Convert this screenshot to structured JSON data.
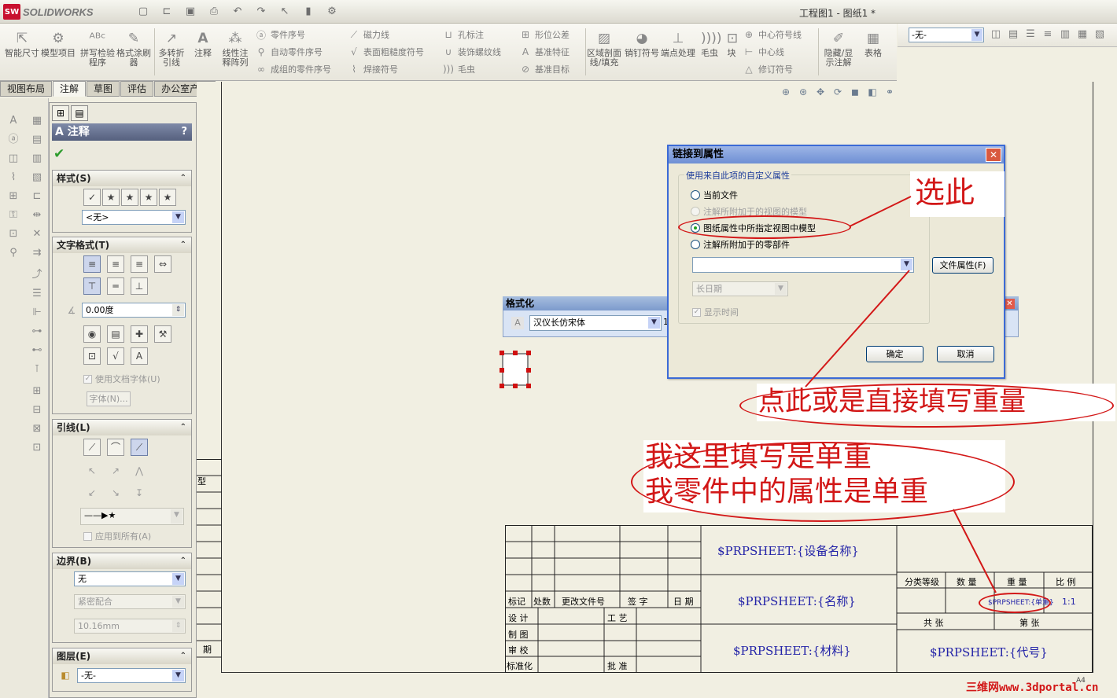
{
  "app": {
    "brand": "SOLIDWORKS",
    "doc_title": "工程图1 - 图纸1 *"
  },
  "quick_access": [
    "new-icon",
    "open-icon",
    "save-icon",
    "print-icon",
    "undo-icon",
    "redo-icon",
    "select-icon",
    "rebuild-icon",
    "options-icon"
  ],
  "command_manager": {
    "big_buttons": [
      {
        "id": "smart-dim",
        "label": "智能尺寸"
      },
      {
        "id": "model-items",
        "label": "模型项目"
      },
      {
        "id": "spell",
        "label": "拼写检验程序"
      },
      {
        "id": "format-painter",
        "label": "格式涂刷器"
      },
      {
        "id": "multi-jog",
        "label": "多转折引线"
      },
      {
        "id": "note",
        "label": "注释"
      },
      {
        "id": "linear-pattern",
        "label": "线性注释阵列"
      }
    ],
    "col1": [
      "零件序号",
      "自动零件序号",
      "成组的零件序号"
    ],
    "col2": [
      "磁力线",
      "表面粗糙度符号",
      "焊接符号"
    ],
    "col3": [
      "孔标注",
      "装饰螺纹线",
      "毛虫"
    ],
    "col4": [
      "形位公差",
      "基准特征",
      "基准目标"
    ],
    "big_buttons2": [
      {
        "id": "area-hatch",
        "label": "区域剖面线/填充"
      },
      {
        "id": "dowel",
        "label": "销钉符号"
      },
      {
        "id": "end-treat",
        "label": "端点处理"
      },
      {
        "id": "caterpillar",
        "label": "毛虫"
      },
      {
        "id": "block",
        "label": "块"
      }
    ],
    "col5": [
      "中心符号线",
      "中心线",
      "修订符号"
    ],
    "big_buttons3": [
      {
        "id": "hide-show",
        "label": "隐藏/显示注解"
      },
      {
        "id": "table",
        "label": "表格"
      }
    ],
    "layer_value": "-无-"
  },
  "tabs": [
    "视图布局",
    "注解",
    "草图",
    "评估",
    "办公室产品"
  ],
  "active_tab": "注解",
  "pm": {
    "title": "注释",
    "help": "?",
    "style": {
      "header": "样式(S)",
      "combo": "<无>"
    },
    "text_format": {
      "header": "文字格式(T)",
      "angle": "0.00度",
      "use_doc_font": "使用文档字体(U)",
      "font_btn": "字体(N)..."
    },
    "leader": {
      "header": "引线(L)",
      "apply_all": "应用到所有(A)"
    },
    "border": {
      "header": "边界(B)",
      "style": "无",
      "size_mode": "紧密配合",
      "padding": "10.16mm"
    },
    "layer": {
      "header": "图层(E)",
      "value": "-无-"
    }
  },
  "format_bar": {
    "title": "格式化",
    "font": "汉仪长仿宋体",
    "size": "1"
  },
  "dialog": {
    "title": "链接到属性",
    "group": "使用来自此项的自定义属性",
    "options": [
      {
        "label": "当前文件",
        "state": "normal"
      },
      {
        "label": "注解所附加于的视图的模型",
        "state": "disabled"
      },
      {
        "label": "图纸属性中所指定视图中模型",
        "state": "selected"
      },
      {
        "label": "注解所附加于的零部件",
        "state": "normal"
      }
    ],
    "property_value": "",
    "date_format": "长日期",
    "show_time": "显示时间",
    "file_props": "文件属性(F)",
    "ok": "确定",
    "cancel": "取消"
  },
  "callouts": {
    "select_this": "选此",
    "click_or_type": "点此或是直接填写重量",
    "line1": "我这里填写是单重",
    "line2": "我零件中的属性是单重"
  },
  "title_block": {
    "row_labels": [
      "标记",
      "处数",
      "更改文件号",
      "签 字",
      "日 期"
    ],
    "staff": [
      "设 计",
      "工 艺",
      "制 图",
      "审 校",
      "标准化",
      "批 准"
    ],
    "prp_device": "$PRPSHEET:{设备名称}",
    "prp_name": "$PRPSHEET:{名称}",
    "prp_material": "$PRPSHEET:{材料}",
    "prp_code": "$PRPSHEET:{代号}",
    "hdr": [
      "分类等级",
      "数 量",
      "重 量",
      "比 例"
    ],
    "weight_value": "$PRPSHEET:{单重}",
    "scale": "1:1",
    "sheets": [
      "共   张",
      "第   张"
    ],
    "left_marks": [
      "型",
      "期"
    ]
  },
  "sheet_size": "A4",
  "watermark": "三维网www.3dportal.cn"
}
